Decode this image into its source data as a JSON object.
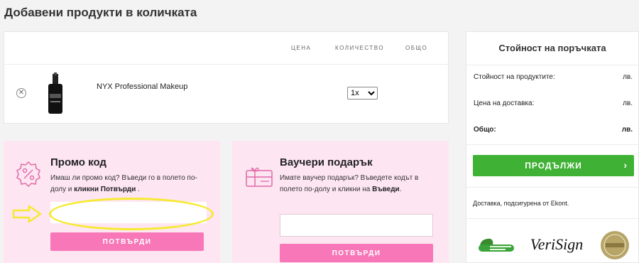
{
  "page": {
    "title": "Добавени продукти в количката"
  },
  "cart": {
    "headers": {
      "price": "ЦЕНА",
      "quantity": "КОЛИЧЕСТВО",
      "total": "ОБЩО"
    },
    "items": [
      {
        "name": "NYX Professional Makeup",
        "quantity": "1x",
        "remove_icon": "close-circle-icon"
      }
    ]
  },
  "promo": {
    "title": "Промо код",
    "text_prefix": "Имаш ли промо код? Въведи го в полето по-долу и ",
    "text_bold": "кликни Потвърди",
    "text_suffix": " .",
    "input_value": "",
    "button": "ПОТВЪРДИ",
    "icon": "percent-badge-icon",
    "highlight_color": "#f6ea2f"
  },
  "voucher": {
    "title": "Ваучери подарък",
    "text_prefix": "Имате ваучер подарък? Въведете кодът в полето по-долу и кликни на ",
    "text_bold": "Въведи",
    "text_suffix": ".",
    "input_value": "",
    "button": "ПОТВЪРДИ",
    "icon": "gift-card-icon"
  },
  "summary": {
    "title": "Стойност на поръчката",
    "rows": [
      {
        "label": "Стойност на продуктите:",
        "value": "лв."
      },
      {
        "label": "Цена на доставка:",
        "value": "лв."
      },
      {
        "label": "Общо:",
        "value": "лв."
      }
    ],
    "continue_button": "ПРОДЪЛЖИ",
    "delivery_note": "Доставка, подсигурена от Ekont.",
    "badges": {
      "verisign": "VeriSign"
    }
  },
  "colors": {
    "accent_green": "#3fb134",
    "accent_pink": "#f777b8",
    "panel_pink": "#fde5f2",
    "highlight": "#f6ea2f"
  }
}
